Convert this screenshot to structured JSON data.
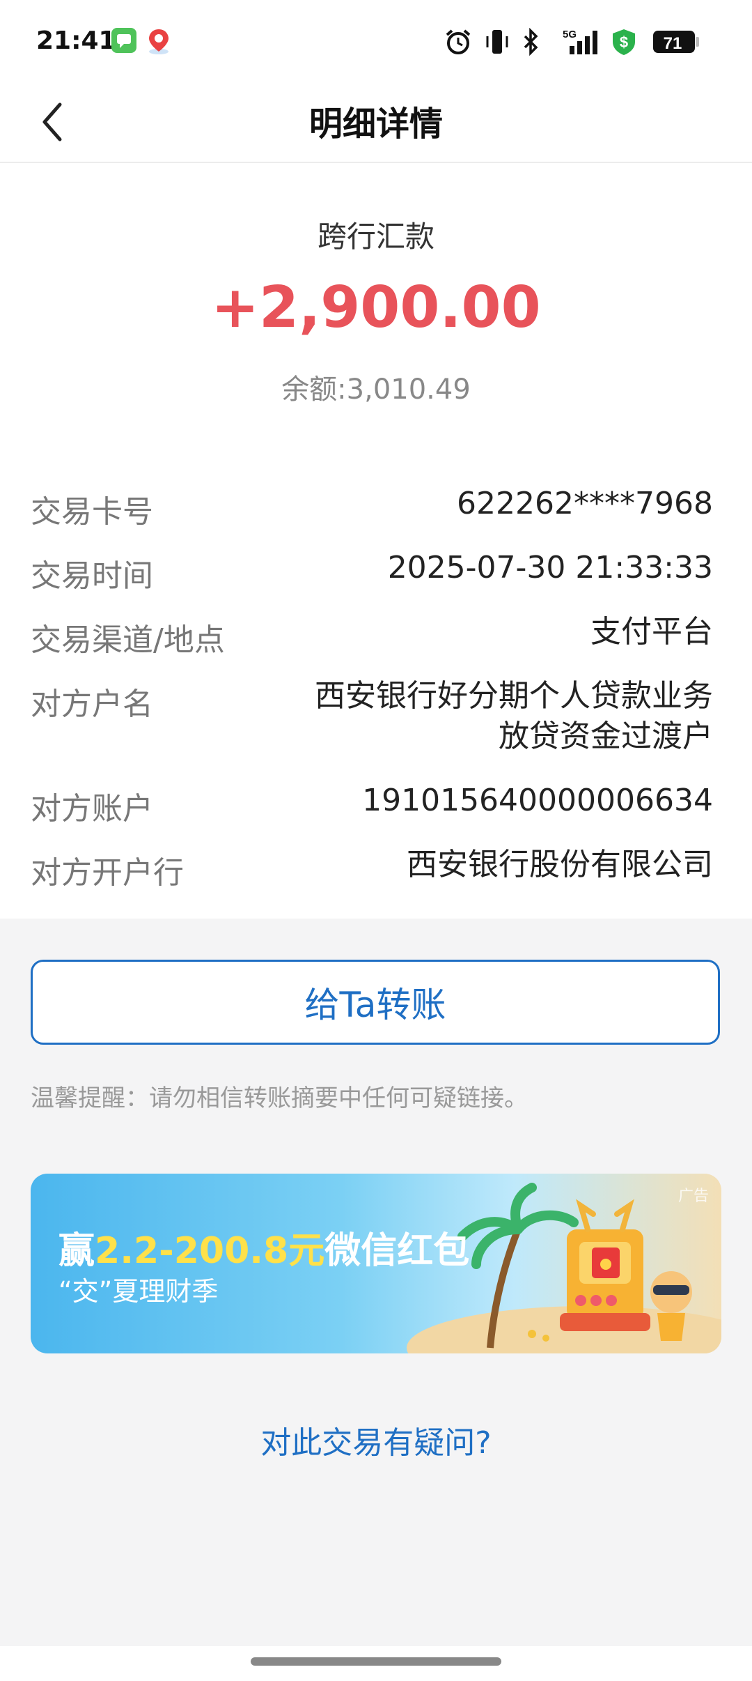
{
  "status_bar": {
    "time": "21:41",
    "battery": "71",
    "network": "5G"
  },
  "header": {
    "title": "明细详情"
  },
  "transaction": {
    "type": "跨行汇款",
    "amount": "+2,900.00",
    "balance": "余额:3,010.49"
  },
  "details": [
    {
      "label": "交易卡号",
      "value": "622262****7968"
    },
    {
      "label": "交易时间",
      "value": "2025-07-30 21:33:33"
    },
    {
      "label": "交易渠道/地点",
      "value": "支付平台"
    },
    {
      "label": "对方户名",
      "value_line1": "西安银行好分期个人贷款业务",
      "value_line2": "放贷资金过渡户"
    },
    {
      "label": "对方账户",
      "value": "191015640000006634"
    },
    {
      "label": "对方开户行",
      "value": "西安银行股份有限公司"
    }
  ],
  "actions": {
    "transfer_label": "给Ta转账"
  },
  "reminder": "温馨提醒：请勿相信转账摘要中任何可疑链接。",
  "banner": {
    "title_prefix": "赢",
    "title_highlight": "2.2-200.8元",
    "title_suffix": "微信红包",
    "subtitle": "“交”夏理财季",
    "ad_tag": "广告"
  },
  "help_link": "对此交易有疑问?",
  "colors": {
    "amount": "#e8535a",
    "accent": "#1f6fc4",
    "highlight": "#ffe14a"
  }
}
